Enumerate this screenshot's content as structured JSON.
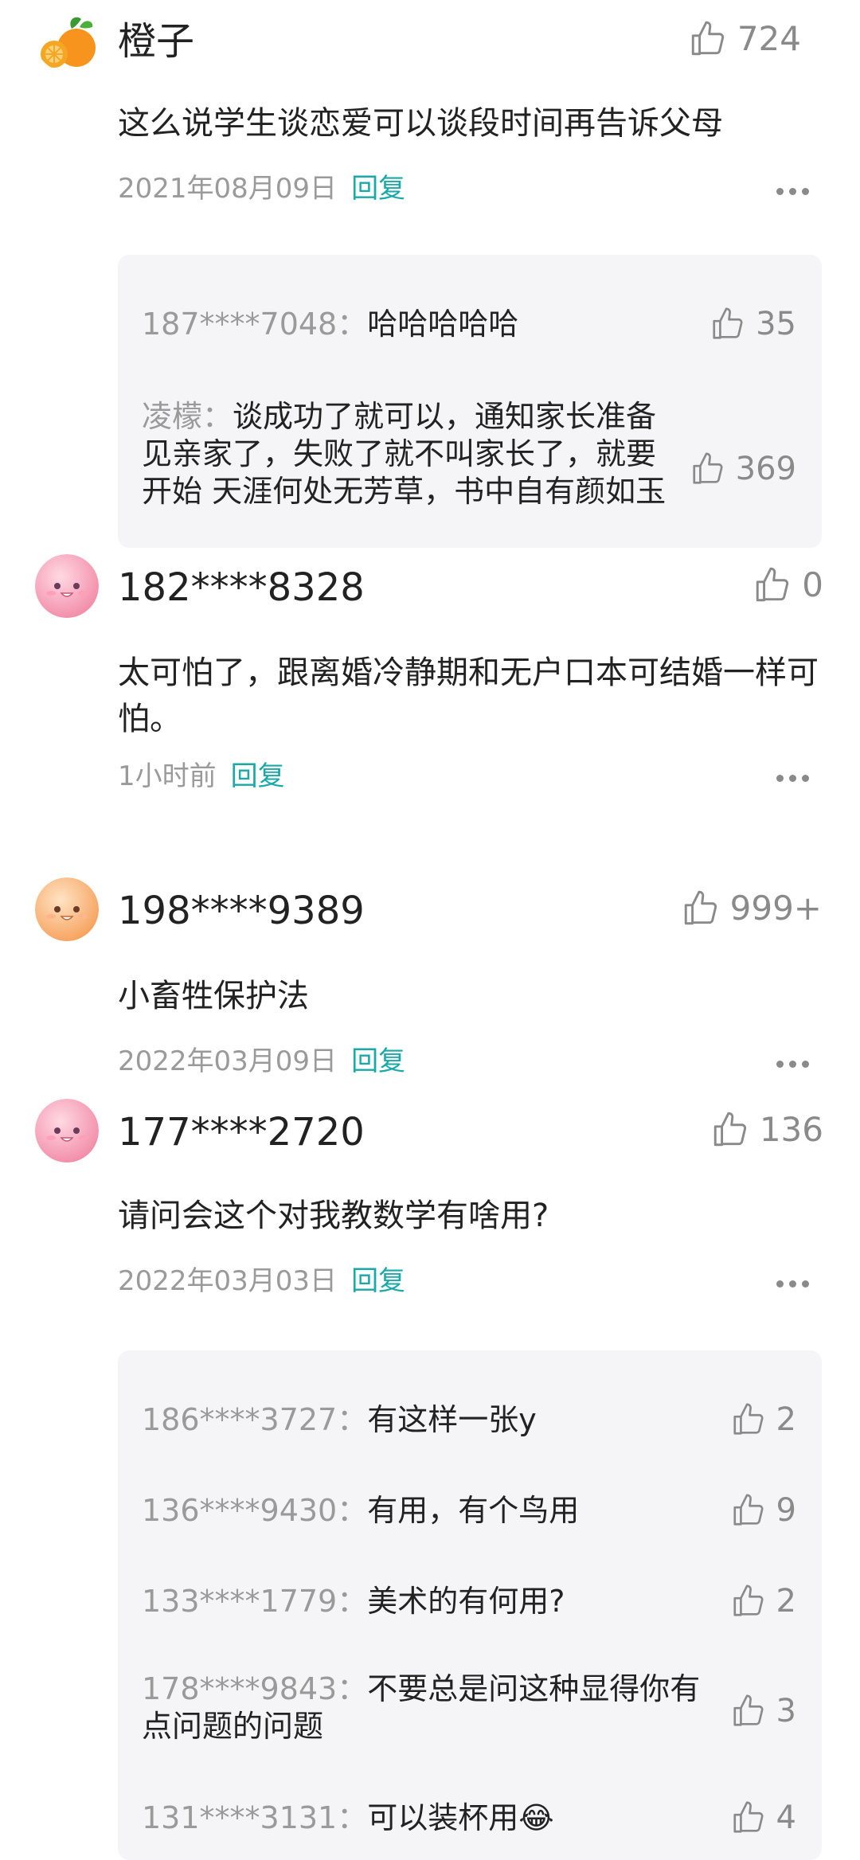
{
  "comments": [
    {
      "avatar_icon": "orange-fruit-icon",
      "username": "橙子",
      "likes": "724",
      "text": "这么说学生谈恋爱可以谈段时间再告诉父母",
      "date": "2021年08月09日",
      "reply_label": "回复",
      "replies": [
        {
          "user": "187****7048：",
          "text": "哈哈哈哈哈",
          "likes": "35"
        },
        {
          "user": "凌檬：",
          "text": "谈成功了就可以，通知家长准备见亲家了，失败了就不叫家长了，就要开始 天涯何处无芳草，书中自有颜如玉",
          "likes": "369"
        }
      ]
    },
    {
      "avatar_icon": "pink-smiley-face-icon",
      "username": "182****8328",
      "likes": "0",
      "text": "太可怕了，跟离婚冷静期和无户口本可结婚一样可怕。",
      "date": "1小时前",
      "reply_label": "回复"
    },
    {
      "avatar_icon": "orange-smiley-face-icon",
      "username": "198****9389",
      "likes": "999+",
      "text": "小畜牲保护法",
      "date": "2022年03月09日",
      "reply_label": "回复"
    },
    {
      "avatar_icon": "pink-smiley-face-icon",
      "username": "177****2720",
      "likes": "136",
      "text": "请问会这个对我教数学有啥用?",
      "date": "2022年03月03日",
      "reply_label": "回复",
      "replies": [
        {
          "user": "186****3727：",
          "text": "有这样一张y",
          "likes": "2"
        },
        {
          "user": "136****9430：",
          "text": "有用，有个鸟用",
          "likes": "9"
        },
        {
          "user": "133****1779：",
          "text": "美术的有何用?",
          "likes": "2"
        },
        {
          "user": "178****9843：",
          "text": "不要总是问这种显得你有点问题的问题",
          "likes": "3"
        },
        {
          "user": "131****3131：",
          "text": "可以装杯用😂",
          "likes": "4"
        }
      ]
    }
  ],
  "colors": {
    "accent": "#1aa9a9",
    "muted": "#9a9a9a",
    "reply_bg": "#f5f5f7"
  }
}
